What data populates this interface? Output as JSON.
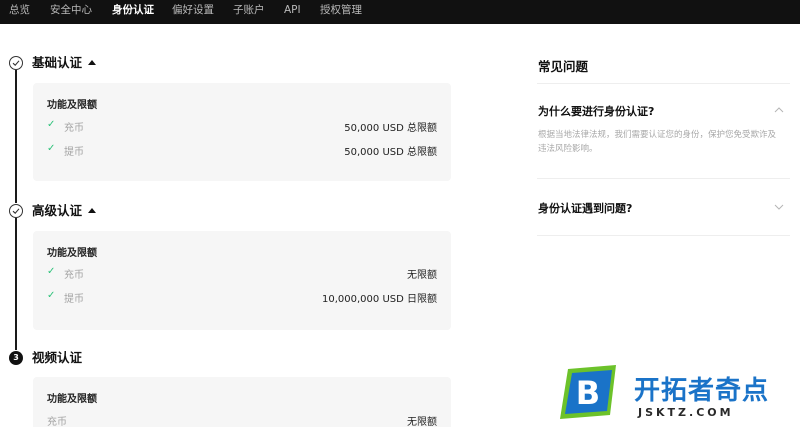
{
  "nav": {
    "items": [
      {
        "label": "总览",
        "active": false
      },
      {
        "label": "安全中心",
        "active": false
      },
      {
        "label": "身份认证",
        "active": true
      },
      {
        "label": "偏好设置",
        "active": false
      },
      {
        "label": "子账户",
        "active": false
      },
      {
        "label": "API",
        "active": false
      },
      {
        "label": "授权管理",
        "active": false
      }
    ]
  },
  "verification": {
    "basic": {
      "title": "基础认证",
      "status": "completed",
      "card_heading": "功能及限额",
      "rows": [
        {
          "label": "充币",
          "value": "50,000 USD 总限额"
        },
        {
          "label": "提币",
          "value": "50,000 USD 总限额"
        }
      ]
    },
    "advanced": {
      "title": "高级认证",
      "status": "completed",
      "card_heading": "功能及限额",
      "rows": [
        {
          "label": "充币",
          "value": "无限额"
        },
        {
          "label": "提币",
          "value": "10,000,000 USD 日限额"
        }
      ]
    },
    "video": {
      "title": "视频认证",
      "step_number": "3",
      "card_heading": "功能及限额",
      "rows": [
        {
          "label": "充币",
          "value": "无限额"
        }
      ]
    }
  },
  "faq": {
    "title": "常见问题",
    "items": [
      {
        "question": "为什么要进行身份认证?",
        "answer": "根据当地法律法规，我们需要认证您的身份，保护您免受欺诈及违法风险影响。",
        "expanded": true
      },
      {
        "question": "身份认证遇到问题?",
        "expanded": false
      }
    ]
  },
  "watermark": {
    "logo_letter": "B",
    "name": "开拓者奇点",
    "site": "JSKTZ.COM"
  },
  "colors": {
    "nav_bg": "#111111",
    "check_green": "#2ec27a",
    "card_bg": "#f6f6f6",
    "watermark_blue": "#1a73c8",
    "watermark_green": "#6cc22a"
  }
}
